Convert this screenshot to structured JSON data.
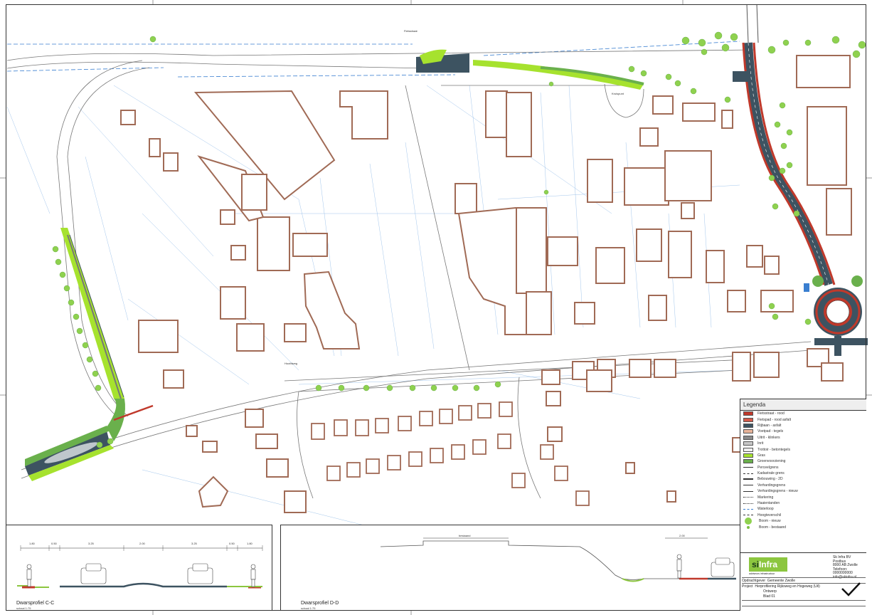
{
  "legend": {
    "title": "Legenda",
    "items": [
      {
        "label": "Fietsstraat - rood",
        "color": "#c0392b",
        "kind": "swatch"
      },
      {
        "label": "Fietspad - rood asfalt",
        "color": "#d35a4a",
        "kind": "swatch"
      },
      {
        "label": "Rijbaan - asfalt",
        "color": "#3d5361",
        "kind": "swatch"
      },
      {
        "label": "Voetpad - tegels",
        "color": "#e8b49a",
        "kind": "swatch"
      },
      {
        "label": "Uitrit - klinkers",
        "color": "#8a8a8a",
        "kind": "swatch"
      },
      {
        "label": "Inrit",
        "color": "#c8c8c8",
        "kind": "swatch"
      },
      {
        "label": "Trottoir - betontegels",
        "color": "#eeeeee",
        "kind": "swatch"
      },
      {
        "label": "Gras",
        "color": "#a6e22e",
        "kind": "swatch"
      },
      {
        "label": "Groenvoorziening",
        "color": "#6ab04c",
        "kind": "swatch"
      },
      {
        "label": "Perceelgrens",
        "kind": "line"
      },
      {
        "label": "Kadastrale grens",
        "kind": "dash"
      },
      {
        "label": "Bebouwing - 2D",
        "kind": "thick"
      },
      {
        "label": "Verhardingsgrens",
        "kind": "line"
      },
      {
        "label": "Verhardingsgrens - nieuw",
        "kind": "line"
      },
      {
        "label": "Markering",
        "kind": "dot"
      },
      {
        "label": "Haaientanden",
        "kind": "dot"
      },
      {
        "label": "Waterloop",
        "kind": "blue"
      },
      {
        "label": "Hoogteverschil",
        "kind": "dash"
      },
      {
        "label": "Boom - nieuw",
        "kind": "tree"
      },
      {
        "label": "Boom - bestaand",
        "kind": "small"
      }
    ]
  },
  "titleblock": {
    "logo_a": "si",
    "logo_b": "Infra",
    "logo_sub": "adviseurs infrastructuur",
    "address": [
      "Sk Infra BV",
      "Postbus",
      "8000 AB Zwolle",
      "Telefoon: 0000000000",
      "info@skinfra.nl"
    ],
    "rows": [
      {
        "k": "Opdrachtgever",
        "v": "Gemeente Zwolle"
      },
      {
        "k": "Project",
        "v": "Herprofilering Rijksweg en Hogeweg (Uil)"
      },
      {
        "k": "",
        "v": "Ontwerp"
      },
      {
        "k": "",
        "v": "Blad 01"
      }
    ]
  },
  "profiles": {
    "left_label": "Dwarsprofiel C-C",
    "left_sub": "schaal 1:75",
    "right_label": "Dwarsprofiel D-D",
    "right_sub": "schaal 1:75",
    "left_dims": [
      "1.80",
      "0.50",
      "3.25",
      "2.00",
      "3.25",
      "0.50",
      "1.80"
    ],
    "right_dims": [
      "bestaand",
      "2.00",
      "fietspad"
    ]
  },
  "map": {
    "labels": [
      "Fietsstraat",
      "Hoofdweg",
      "Kruispunt"
    ]
  }
}
